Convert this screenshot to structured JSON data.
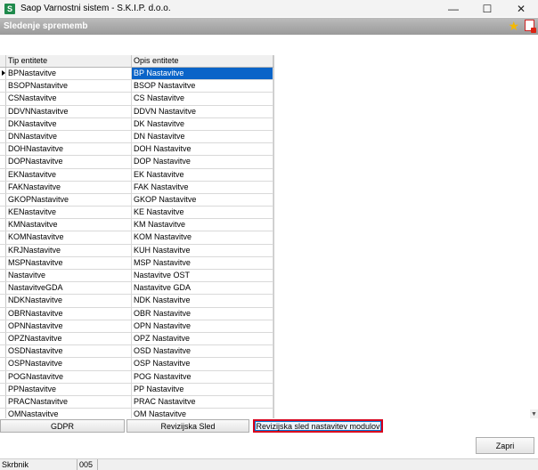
{
  "window": {
    "app_icon_letter": "S",
    "title": "Saop Varnostni sistem - S.K.I.P. d.o.o.",
    "controls": {
      "minimize": "—",
      "maximize": "☐",
      "close": "✕"
    }
  },
  "header": {
    "title": "Sledenje sprememb"
  },
  "grid": {
    "columns": [
      "Tip entitete",
      "Opis entitete"
    ],
    "rows": [
      [
        "BPNastavitve",
        "BP Nastavitve"
      ],
      [
        "BSOPNastavitve",
        "BSOP Nastavitve"
      ],
      [
        "CSNastavitve",
        "CS Nastavitve"
      ],
      [
        "DDVNNastavitve",
        "DDVN Nastavitve"
      ],
      [
        "DKNastavitve",
        "DK Nastavitve"
      ],
      [
        "DNNastavitve",
        "DN Nastavitve"
      ],
      [
        "DOHNastavitve",
        "DOH Nastavitve"
      ],
      [
        "DOPNastavitve",
        "DOP Nastavitve"
      ],
      [
        "EKNastavitve",
        "EK Nastavitve"
      ],
      [
        "FAKNastavitve",
        "FAK Nastavitve"
      ],
      [
        "GKOPNastavitve",
        "GKOP Nastavitve"
      ],
      [
        "KENastavitve",
        "KE Nastavitve"
      ],
      [
        "KMNastavitve",
        "KM Nastavitve"
      ],
      [
        "KOMNastavitve",
        "KOM Nastavitve"
      ],
      [
        "KRJNastavitve",
        "KUH Nastavitve"
      ],
      [
        "MSPNastavitve",
        "MSP Nastavitve"
      ],
      [
        "Nastavitve",
        "Nastavitve OST"
      ],
      [
        "NastavitveGDA",
        "Nastavitve GDA"
      ],
      [
        "NDKNastavitve",
        "NDK Nastavitve"
      ],
      [
        "OBRNastavitve",
        "OBR Nastavitve"
      ],
      [
        "OPNNastavitve",
        "OPN Nastavitve"
      ],
      [
        "OPZNastavitve",
        "OPZ Nastavitve"
      ],
      [
        "OSDNastavitve",
        "OSD Nastavitve"
      ],
      [
        "OSPNastavitve",
        "OSP Nastavitve"
      ],
      [
        "POGNastavitve",
        "POG Nastavitve"
      ],
      [
        "PPNastavitve",
        "PP Nastavitve"
      ],
      [
        "PRACNastavitve",
        "PRAC Nastavitve"
      ],
      [
        "OMNastavitve",
        "OM Nastavitve"
      ]
    ],
    "selected_index": 0
  },
  "buttons": {
    "gdpr": "GDPR",
    "revizijska_sled": "Revizijska Sled",
    "revizijska_sled_modulov": "Revizijska sled nastavitev modulov",
    "zapri": "Zapri"
  },
  "statusbar": {
    "user": "Skrbnik",
    "code": "005"
  },
  "colors": {
    "selection": "#0a64c8",
    "highlight_border": "#d8001c",
    "header_band": "#a8a8a8"
  }
}
